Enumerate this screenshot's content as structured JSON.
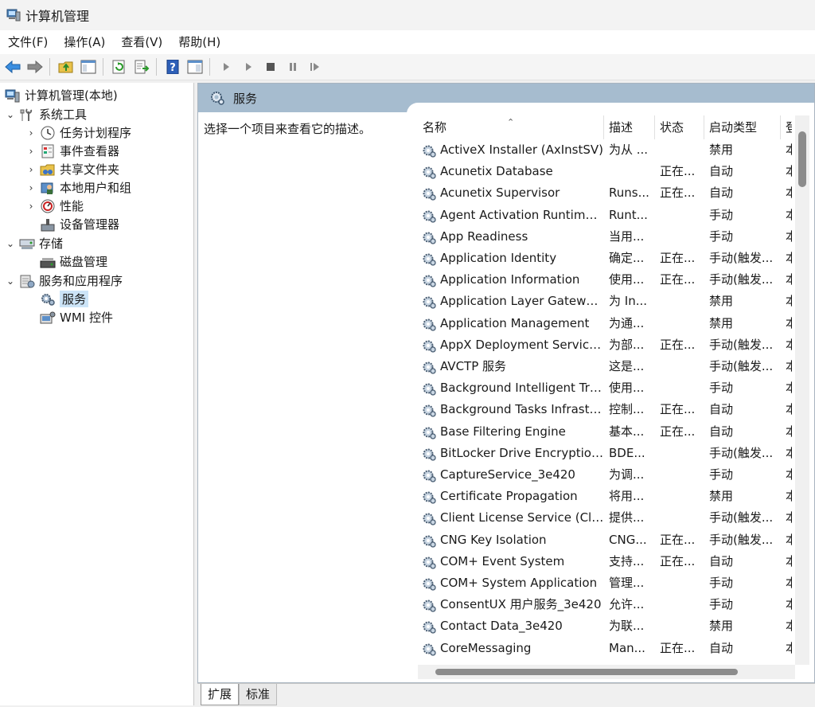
{
  "window": {
    "title": "计算机管理"
  },
  "menu": [
    {
      "label": "文件(F)"
    },
    {
      "label": "操作(A)"
    },
    {
      "label": "查看(V)"
    },
    {
      "label": "帮助(H)"
    }
  ],
  "toolbar": {
    "icons": [
      "back-arrow-icon",
      "forward-arrow-icon",
      "folder-up-icon",
      "show-hide-tree-icon",
      "refresh-icon",
      "export-list-icon",
      "help-icon",
      "properties-icon",
      "start-service-icon",
      "start-service-alt-icon",
      "stop-service-icon",
      "pause-service-icon",
      "restart-service-icon"
    ]
  },
  "tree": [
    {
      "label": "计算机管理(本地)",
      "level": 0,
      "caret": "",
      "icon": "computer-management-icon"
    },
    {
      "label": "系统工具",
      "level": 1,
      "caret": "expanded",
      "icon": "system-tools-icon"
    },
    {
      "label": "任务计划程序",
      "level": 2,
      "caret": "collapsed",
      "icon": "task-scheduler-icon"
    },
    {
      "label": "事件查看器",
      "level": 2,
      "caret": "collapsed",
      "icon": "event-viewer-icon"
    },
    {
      "label": "共享文件夹",
      "level": 2,
      "caret": "collapsed",
      "icon": "shared-folders-icon"
    },
    {
      "label": "本地用户和组",
      "level": 2,
      "caret": "collapsed",
      "icon": "local-users-icon"
    },
    {
      "label": "性能",
      "level": 2,
      "caret": "collapsed",
      "icon": "performance-icon"
    },
    {
      "label": "设备管理器",
      "level": 2,
      "caret": "",
      "icon": "device-manager-icon"
    },
    {
      "label": "存储",
      "level": 1,
      "caret": "expanded",
      "icon": "storage-icon"
    },
    {
      "label": "磁盘管理",
      "level": 2,
      "caret": "",
      "icon": "disk-management-icon"
    },
    {
      "label": "服务和应用程序",
      "level": 1,
      "caret": "expanded",
      "icon": "services-apps-icon"
    },
    {
      "label": "服务",
      "level": 2,
      "caret": "",
      "icon": "services-icon",
      "selected": true
    },
    {
      "label": "WMI 控件",
      "level": 2,
      "caret": "",
      "icon": "wmi-control-icon"
    }
  ],
  "main": {
    "header_title": "服务",
    "description": "选择一个项目来查看它的描述。",
    "columns": [
      "名称",
      "描述",
      "状态",
      "启动类型",
      "登"
    ],
    "services": [
      {
        "name": "ActiveX Installer (AxInstSV)",
        "desc": "为从 ...",
        "status": "",
        "startup": "禁用",
        "logon": "本"
      },
      {
        "name": "Acunetix Database",
        "desc": "",
        "status": "正在...",
        "startup": "自动",
        "logon": "本"
      },
      {
        "name": "Acunetix Supervisor",
        "desc": "Runs...",
        "status": "正在...",
        "startup": "自动",
        "logon": "本"
      },
      {
        "name": "Agent Activation Runtime_...",
        "desc": "Runt...",
        "status": "",
        "startup": "手动",
        "logon": "本"
      },
      {
        "name": "App Readiness",
        "desc": "当用...",
        "status": "",
        "startup": "手动",
        "logon": "本"
      },
      {
        "name": "Application Identity",
        "desc": "确定...",
        "status": "正在...",
        "startup": "手动(触发...",
        "logon": "本"
      },
      {
        "name": "Application Information",
        "desc": "使用...",
        "status": "正在...",
        "startup": "手动(触发...",
        "logon": "本"
      },
      {
        "name": "Application Layer Gateway ...",
        "desc": "为 In...",
        "status": "",
        "startup": "禁用",
        "logon": "本"
      },
      {
        "name": "Application Management",
        "desc": "为通...",
        "status": "",
        "startup": "禁用",
        "logon": "本"
      },
      {
        "name": "AppX Deployment Service ...",
        "desc": "为部...",
        "status": "正在...",
        "startup": "手动(触发...",
        "logon": "本"
      },
      {
        "name": "AVCTP 服务",
        "desc": "这是...",
        "status": "",
        "startup": "手动(触发...",
        "logon": "本"
      },
      {
        "name": "Background Intelligent Tra...",
        "desc": "使用...",
        "status": "",
        "startup": "手动",
        "logon": "本"
      },
      {
        "name": "Background Tasks Infrastru...",
        "desc": "控制...",
        "status": "正在...",
        "startup": "自动",
        "logon": "本"
      },
      {
        "name": "Base Filtering Engine",
        "desc": "基本...",
        "status": "正在...",
        "startup": "自动",
        "logon": "本"
      },
      {
        "name": "BitLocker Drive Encryption ...",
        "desc": "BDE...",
        "status": "",
        "startup": "手动(触发...",
        "logon": "本"
      },
      {
        "name": "CaptureService_3e420",
        "desc": "为调...",
        "status": "",
        "startup": "手动",
        "logon": "本"
      },
      {
        "name": "Certificate Propagation",
        "desc": "将用...",
        "status": "",
        "startup": "禁用",
        "logon": "本"
      },
      {
        "name": "Client License Service (Clip...",
        "desc": "提供...",
        "status": "",
        "startup": "手动(触发...",
        "logon": "本"
      },
      {
        "name": "CNG Key Isolation",
        "desc": "CNG...",
        "status": "正在...",
        "startup": "手动(触发...",
        "logon": "本"
      },
      {
        "name": "COM+ Event System",
        "desc": "支持...",
        "status": "正在...",
        "startup": "自动",
        "logon": "本"
      },
      {
        "name": "COM+ System Application",
        "desc": "管理...",
        "status": "",
        "startup": "手动",
        "logon": "本"
      },
      {
        "name": "ConsentUX 用户服务_3e420",
        "desc": "允许...",
        "status": "",
        "startup": "手动",
        "logon": "本"
      },
      {
        "name": "Contact Data_3e420",
        "desc": "为联...",
        "status": "",
        "startup": "禁用",
        "logon": "本"
      },
      {
        "name": "CoreMessaging",
        "desc": "Man...",
        "status": "正在...",
        "startup": "自动",
        "logon": "本"
      }
    ]
  },
  "tabs": [
    {
      "label": "扩展",
      "active": true
    },
    {
      "label": "标准",
      "active": false
    }
  ]
}
